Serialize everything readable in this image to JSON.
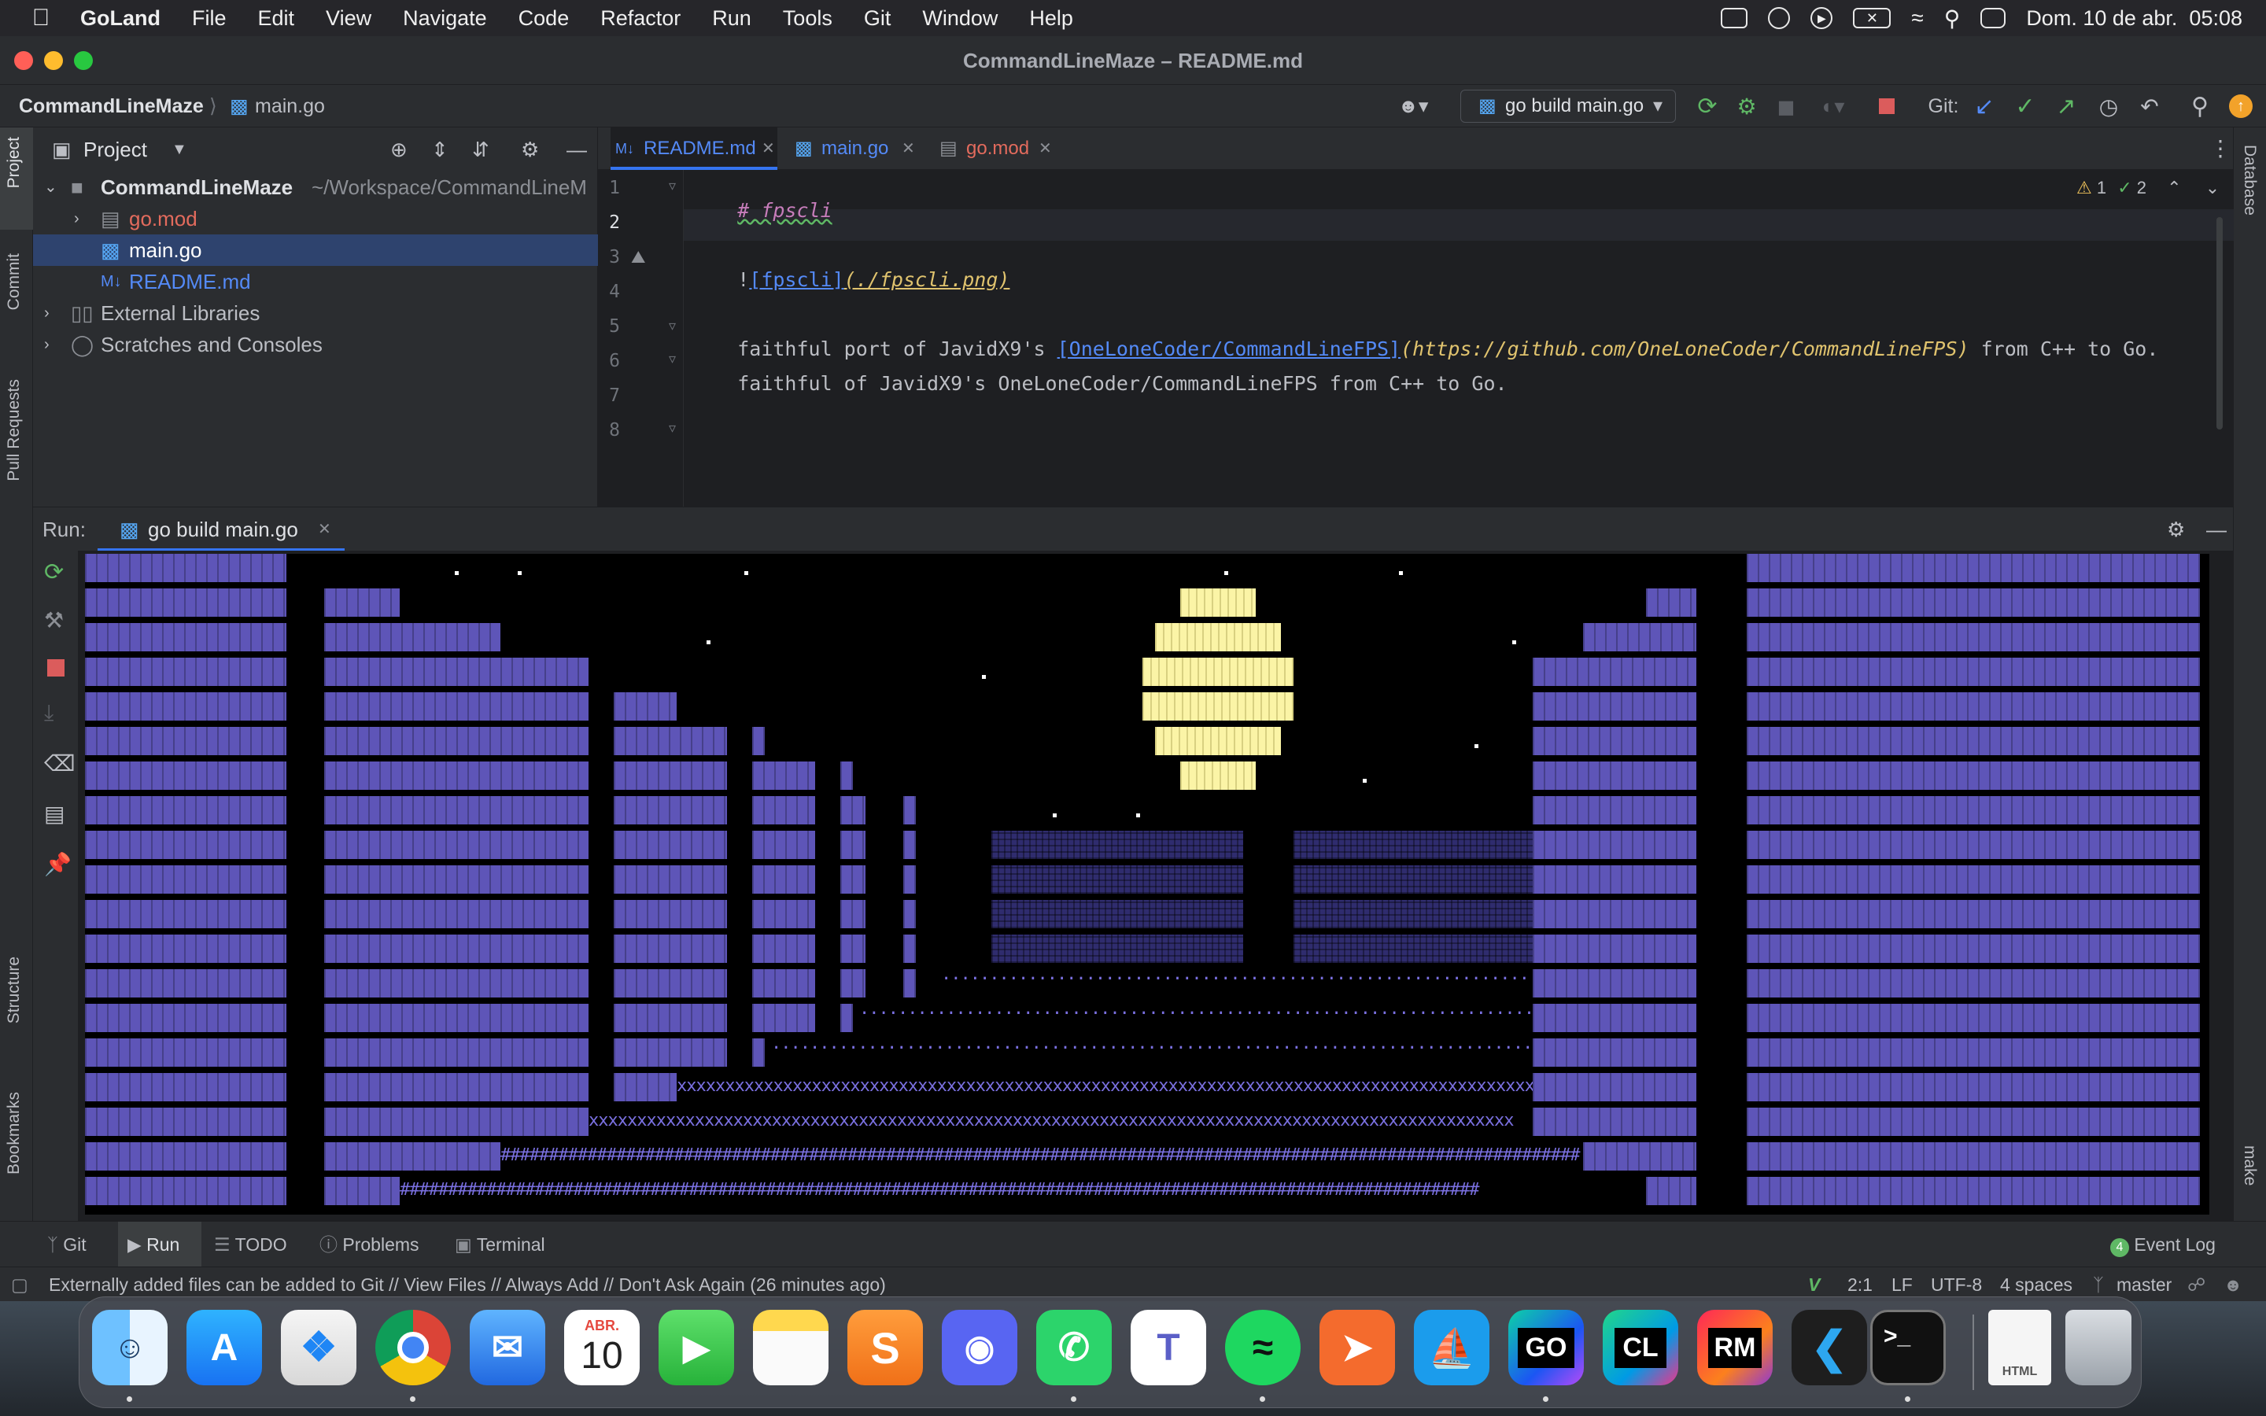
{
  "menubar": {
    "app": "GoLand",
    "items": [
      "File",
      "Edit",
      "View",
      "Navigate",
      "Code",
      "Refactor",
      "Run",
      "Tools",
      "Git",
      "Window",
      "Help"
    ],
    "clock": "Dom. 10 de abr.  05:08"
  },
  "window": {
    "title": "CommandLineMaze – README.md"
  },
  "navbar": {
    "project": "CommandLineMaze",
    "file": "main.go",
    "run_config": "go build main.go",
    "git_label": "Git:"
  },
  "project_panel": {
    "title": "Project",
    "tree": [
      {
        "label": "CommandLineMaze",
        "hint": "~/Workspace/CommandLineM"
      },
      {
        "label": "go.mod"
      },
      {
        "label": "main.go"
      },
      {
        "label": "README.md"
      },
      {
        "label": "External Libraries"
      },
      {
        "label": "Scratches and Consoles"
      }
    ]
  },
  "editor": {
    "tabs": [
      "README.md",
      "main.go",
      "go.mod"
    ],
    "inspections": {
      "warnings": "1",
      "checks": "2"
    },
    "line_numbers": [
      "1",
      "2",
      "3",
      "4",
      "5",
      "6",
      "7",
      "8"
    ],
    "lines": {
      "l1": "# fpscli",
      "l3_bang": "!",
      "l3_alt": "[fpscli]",
      "l3_url": "(./fpscli.png)",
      "l5_a": "faithful port of JavidX9's ",
      "l5_link": "[OneLoneCoder/CommandLineFPS]",
      "l5_url": "(https://github.com/OneLoneCoder/CommandLineFPS)",
      "l5_b": " from C++ to Go.",
      "l6": "faithful of JavidX9's OneLoneCoder/CommandLineFPS from C++ to Go."
    }
  },
  "run_panel": {
    "label": "Run:",
    "tab": "go build main.go",
    "floor_chars": {
      "dots": "...................................................................................................",
      "x": "xxxxxxxxxxxxxxxxxxxxxxxxxxxxxxxxxxxxxxxxxxxxxxxxxxxxxxxxxxxxxxxxxxxxxxxxxxxxxxxxxxxxxxxxxxxxxxxx",
      "hash": "################################################################################################################"
    }
  },
  "left_strip": {
    "tabs": [
      "Project",
      "Commit",
      "Pull Requests",
      "Structure",
      "Bookmarks"
    ]
  },
  "right_strip": {
    "tabs": [
      "Database",
      "make"
    ]
  },
  "bottom_tabs": [
    "Git",
    "Run",
    "TODO",
    "Problems",
    "Terminal"
  ],
  "event_log": {
    "count": "4",
    "label": "Event Log"
  },
  "status": {
    "message": "Externally added files can be added to Git // View Files // Always Add // Don't Ask Again (26 minutes ago)",
    "position": "2:1",
    "line_sep": "LF",
    "encoding": "UTF-8",
    "indent": "4 spaces",
    "branch": "master"
  },
  "dock": {
    "calendar_month": "ABR.",
    "calendar_day": "10",
    "apps": [
      "Finder",
      "App Store",
      "Safari",
      "Chrome",
      "Mail",
      "Calendar",
      "FaceTime",
      "Notes",
      "Sublime",
      "Discord",
      "WhatsApp",
      "Teams",
      "Spotify",
      "Postman",
      "Docker",
      "GoLand",
      "CLion",
      "RubyMine",
      "VS Code",
      "Terminal",
      "HTML file",
      "Trash"
    ],
    "labels": {
      "goland": "GO",
      "clion": "CL",
      "rubymine": "RM",
      "terminal": ">_",
      "html": "HTML"
    }
  },
  "colors": {
    "accent": "#3574f0",
    "wall": "#5e55b8",
    "moon": "#fbf4a6",
    "sel": "#2e436e"
  }
}
